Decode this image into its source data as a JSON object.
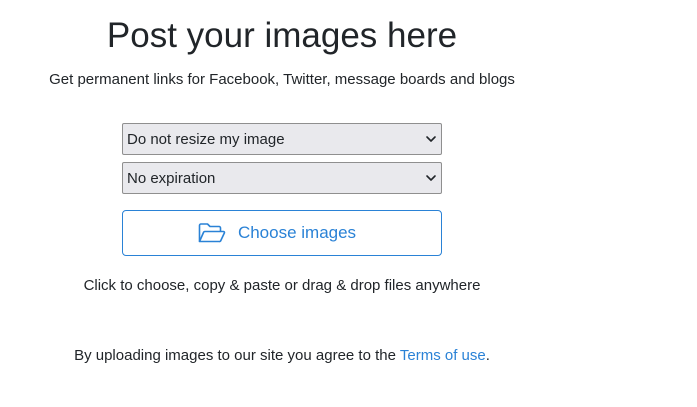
{
  "hero": {
    "title": "Post your images here",
    "subtitle": "Get permanent links for Facebook, Twitter, message boards and blogs"
  },
  "form": {
    "resize_select": {
      "selected": "Do not resize my image"
    },
    "expiration_select": {
      "selected": "No expiration"
    },
    "choose_button": {
      "label": "Choose images",
      "icon": "folder-open-icon"
    },
    "hint": "Click to choose, copy & paste or drag & drop files anywhere"
  },
  "terms": {
    "prefix": "By uploading images to our site you agree to the ",
    "link_label": "Terms of use",
    "suffix": "."
  },
  "colors": {
    "accent": "#2a82d6",
    "text": "#212529",
    "select_bg": "#e9e9ed"
  }
}
